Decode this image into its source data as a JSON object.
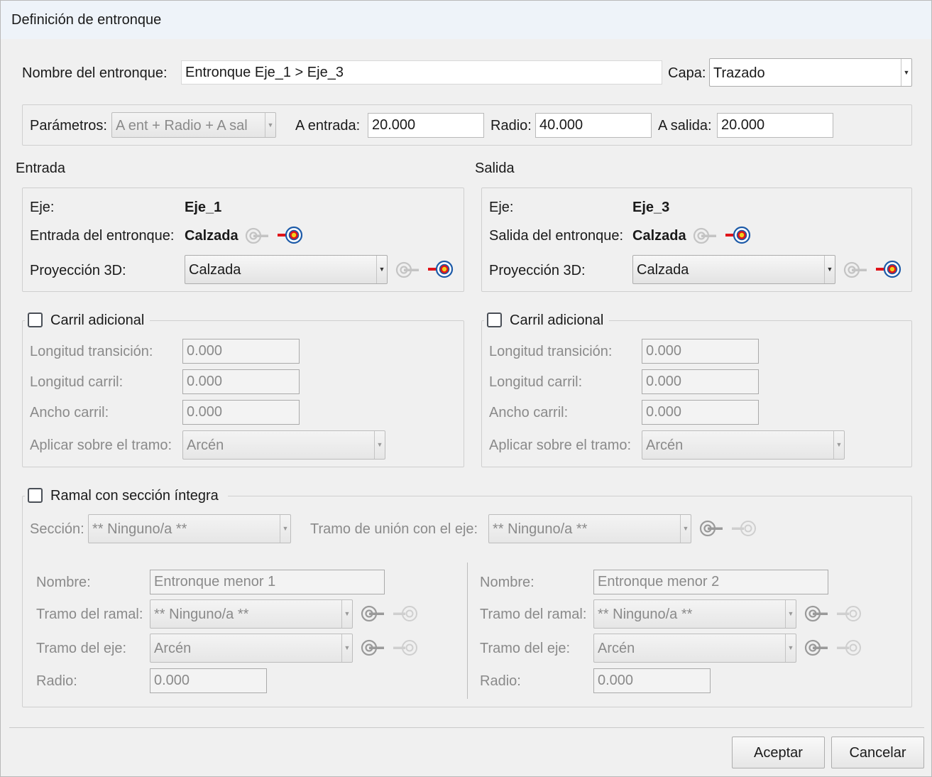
{
  "window": {
    "title": "Definición de entronque"
  },
  "header": {
    "name_label": "Nombre del entronque:",
    "name_value": "Entronque Eje_1 > Eje_3",
    "layer_label": "Capa:",
    "layer_value": "Trazado"
  },
  "params": {
    "label": "Parámetros:",
    "combo_value": "A ent + Radio + A sal",
    "a_entrada_label": "A entrada:",
    "a_entrada_value": "20.000",
    "radio_label": "Radio:",
    "radio_value": "40.000",
    "a_salida_label": "A salida:",
    "a_salida_value": "20.000"
  },
  "entrada": {
    "section_title": "Entrada",
    "eje_label": "Eje:",
    "eje_value": "Eje_1",
    "point_label": "Entrada del entronque:",
    "point_value": "Calzada",
    "proj_label": "Proyección 3D:",
    "proj_value": "Calzada",
    "carril": {
      "title": "Carril adicional",
      "trans_label": "Longitud transición:",
      "trans_value": "0.000",
      "long_label": "Longitud carril:",
      "long_value": "0.000",
      "ancho_label": "Ancho carril:",
      "ancho_value": "0.000",
      "aplicar_label": "Aplicar sobre el tramo:",
      "aplicar_value": "Arcén"
    }
  },
  "salida": {
    "section_title": "Salida",
    "eje_label": "Eje:",
    "eje_value": "Eje_3",
    "point_label": "Salida del entronque:",
    "point_value": "Calzada",
    "proj_label": "Proyección 3D:",
    "proj_value": "Calzada",
    "carril": {
      "title": "Carril adicional",
      "trans_label": "Longitud transición:",
      "trans_value": "0.000",
      "long_label": "Longitud carril:",
      "long_value": "0.000",
      "ancho_label": "Ancho carril:",
      "ancho_value": "0.000",
      "aplicar_label": "Aplicar sobre el tramo:",
      "aplicar_value": "Arcén"
    }
  },
  "ramal": {
    "title": "Ramal con sección íntegra",
    "seccion_label": "Sección:",
    "seccion_value": "** Ninguno/a **",
    "union_label": "Tramo de unión con el eje:",
    "union_value": "** Ninguno/a **",
    "left": {
      "nombre_label": "Nombre:",
      "nombre_value": "Entronque menor 1",
      "tramo_ramal_label": "Tramo del ramal:",
      "tramo_ramal_value": "** Ninguno/a **",
      "tramo_eje_label": "Tramo del eje:",
      "tramo_eje_value": "Arcén",
      "radio_label": "Radio:",
      "radio_value": "0.000"
    },
    "right": {
      "nombre_label": "Nombre:",
      "nombre_value": "Entronque menor 2",
      "tramo_ramal_label": "Tramo del ramal:",
      "tramo_ramal_value": "** Ninguno/a **",
      "tramo_eje_label": "Tramo del eje:",
      "tramo_eje_value": "Arcén",
      "radio_label": "Radio:",
      "radio_value": "0.000"
    }
  },
  "buttons": {
    "ok": "Aceptar",
    "cancel": "Cancelar"
  },
  "icons": {
    "pick_point": "pick-point-icon",
    "target_point": "target-point-icon",
    "dropdown": "chevron-down-icon"
  },
  "colors": {
    "accent": "#1c5aa8",
    "pick_line": "#e0141a",
    "target_center": "#f2d01c"
  }
}
